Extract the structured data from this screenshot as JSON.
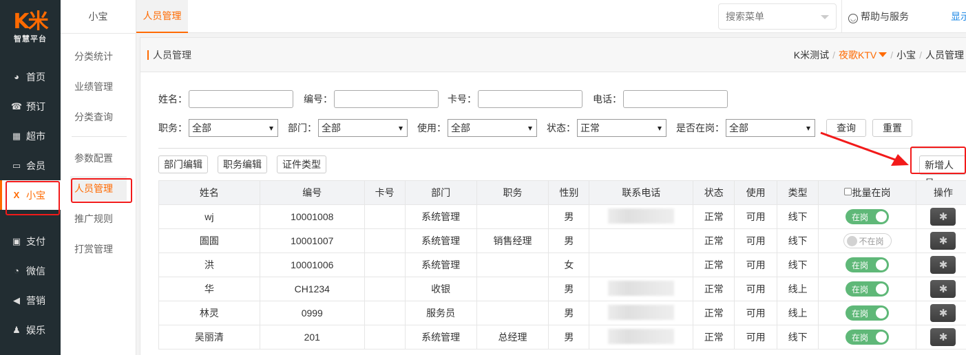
{
  "brand": {
    "logo": "K米",
    "subtitle": "智慧平台",
    "accent": "#ff6a00"
  },
  "sidebar": {
    "items": [
      {
        "label": "首页",
        "icon": "dashboard-icon",
        "glyph": "◕"
      },
      {
        "label": "预订",
        "icon": "phone-icon",
        "glyph": "☎"
      },
      {
        "label": "超市",
        "icon": "basket-icon",
        "glyph": "▦"
      },
      {
        "label": "会员",
        "icon": "card-icon",
        "glyph": "▭"
      },
      {
        "label": "小宝",
        "icon": "xiaobao-icon",
        "glyph": "X",
        "active": true
      },
      {
        "label": "支付",
        "icon": "money-icon",
        "glyph": "▣"
      },
      {
        "label": "微信",
        "icon": "wechat-icon",
        "glyph": "◔"
      },
      {
        "label": "营销",
        "icon": "megaphone-icon",
        "glyph": "◀"
      },
      {
        "label": "娱乐",
        "icon": "entertainment-icon",
        "glyph": "♟"
      }
    ]
  },
  "submenu": {
    "title": "小宝",
    "items": [
      {
        "label": "分类统计"
      },
      {
        "label": "业绩管理"
      },
      {
        "label": "分类查询"
      },
      {
        "label": "参数配置"
      },
      {
        "label": "人员管理",
        "active": true
      },
      {
        "label": "推广规则"
      },
      {
        "label": "打赏管理"
      }
    ]
  },
  "topbar": {
    "tab": "人员管理",
    "search_menu_placeholder": "搜索菜单",
    "help": "帮助与服务",
    "show_link": "显示"
  },
  "header": {
    "title": "人员管理",
    "breadcrumb": [
      "K米测试",
      "夜歌KTV",
      "小宝",
      "人员管理"
    ]
  },
  "filters": {
    "name_label": "姓名：",
    "name_value": "",
    "code_label": "编号：",
    "code_value": "",
    "card_label": "卡号：",
    "card_value": "",
    "phone_label": "电话：",
    "phone_value": "",
    "position_label": "职务：",
    "position_value": "全部",
    "dept_label": "部门：",
    "dept_value": "全部",
    "usage_label": "使用：",
    "usage_value": "全部",
    "status_label": "状态：",
    "status_value": "正常",
    "onduty_label": "是否在岗：",
    "onduty_value": "全部",
    "query_button": "查询",
    "reset_button": "重置"
  },
  "toolbar": {
    "dept_edit": "部门编辑",
    "position_edit": "职务编辑",
    "id_type": "证件类型",
    "add_staff": "新增人员"
  },
  "table": {
    "headers": [
      "姓名",
      "编号",
      "卡号",
      "部门",
      "职务",
      "性别",
      "联系电话",
      "状态",
      "使用",
      "类型",
      "批量在岗",
      "操作"
    ],
    "rows": [
      {
        "name": "wj",
        "code": "10001008",
        "card": "",
        "dept": "系统管理",
        "position": "",
        "gender": "男",
        "phone_blurred": true,
        "status": "正常",
        "usage": "可用",
        "type": "线下",
        "on_duty": true,
        "duty_label": "在岗"
      },
      {
        "name": "圄圄",
        "code": "10001007",
        "card": "",
        "dept": "系统管理",
        "position": "销售经理",
        "gender": "男",
        "phone_blurred": false,
        "status": "正常",
        "usage": "可用",
        "type": "线下",
        "on_duty": false,
        "duty_label": "不在岗"
      },
      {
        "name": "洪",
        "code": "10001006",
        "card": "",
        "dept": "系统管理",
        "position": "",
        "gender": "女",
        "phone_blurred": false,
        "status": "正常",
        "usage": "可用",
        "type": "线下",
        "on_duty": true,
        "duty_label": "在岗"
      },
      {
        "name": "华",
        "code": "CH1234",
        "card": "",
        "dept": "收银",
        "position": "",
        "gender": "男",
        "phone_blurred": true,
        "status": "正常",
        "usage": "可用",
        "type": "线上",
        "on_duty": true,
        "duty_label": "在岗"
      },
      {
        "name": "林灵",
        "code": "0999",
        "card": "",
        "dept": "服务员",
        "position": "",
        "gender": "男",
        "phone_blurred": true,
        "status": "正常",
        "usage": "可用",
        "type": "线上",
        "on_duty": true,
        "duty_label": "在岗"
      },
      {
        "name": "吴丽清",
        "code": "201",
        "card": "",
        "dept": "系统管理",
        "position": "总经理",
        "gender": "男",
        "phone_blurred": true,
        "status": "正常",
        "usage": "可用",
        "type": "线下",
        "on_duty": true,
        "duty_label": "在岗"
      }
    ]
  },
  "annotation": {
    "color": "#f21a1a"
  }
}
